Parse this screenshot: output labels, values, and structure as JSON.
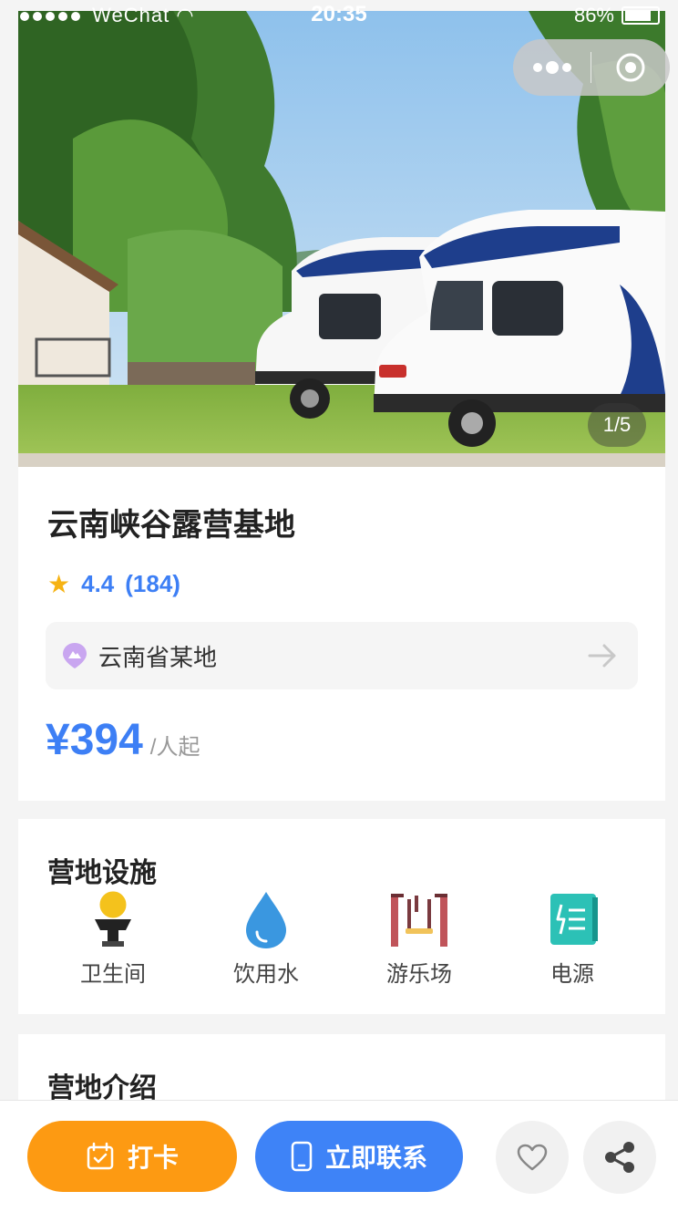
{
  "status_bar": {
    "carrier": "WeChat",
    "time": "20:35",
    "battery": "86%"
  },
  "hero": {
    "pager": "1/5"
  },
  "camp": {
    "name": "云南峡谷露营基地",
    "rating": "4.4",
    "reviews": "(184)",
    "location": "云南省某地",
    "price": "¥394",
    "price_unit": "/人起"
  },
  "facilities": {
    "title": "营地设施",
    "items": [
      {
        "label": "卫生间",
        "icon": "toilet-icon"
      },
      {
        "label": "饮用水",
        "icon": "water-drop-icon"
      },
      {
        "label": "游乐场",
        "icon": "playground-icon"
      },
      {
        "label": "电源",
        "icon": "power-icon"
      }
    ]
  },
  "intro": {
    "title": "营地介绍"
  },
  "actions": {
    "checkin": "打卡",
    "contact": "立即联系"
  },
  "colors": {
    "accent_blue": "#3e83f7",
    "accent_orange": "#fd9a12",
    "star": "#f6b314"
  }
}
